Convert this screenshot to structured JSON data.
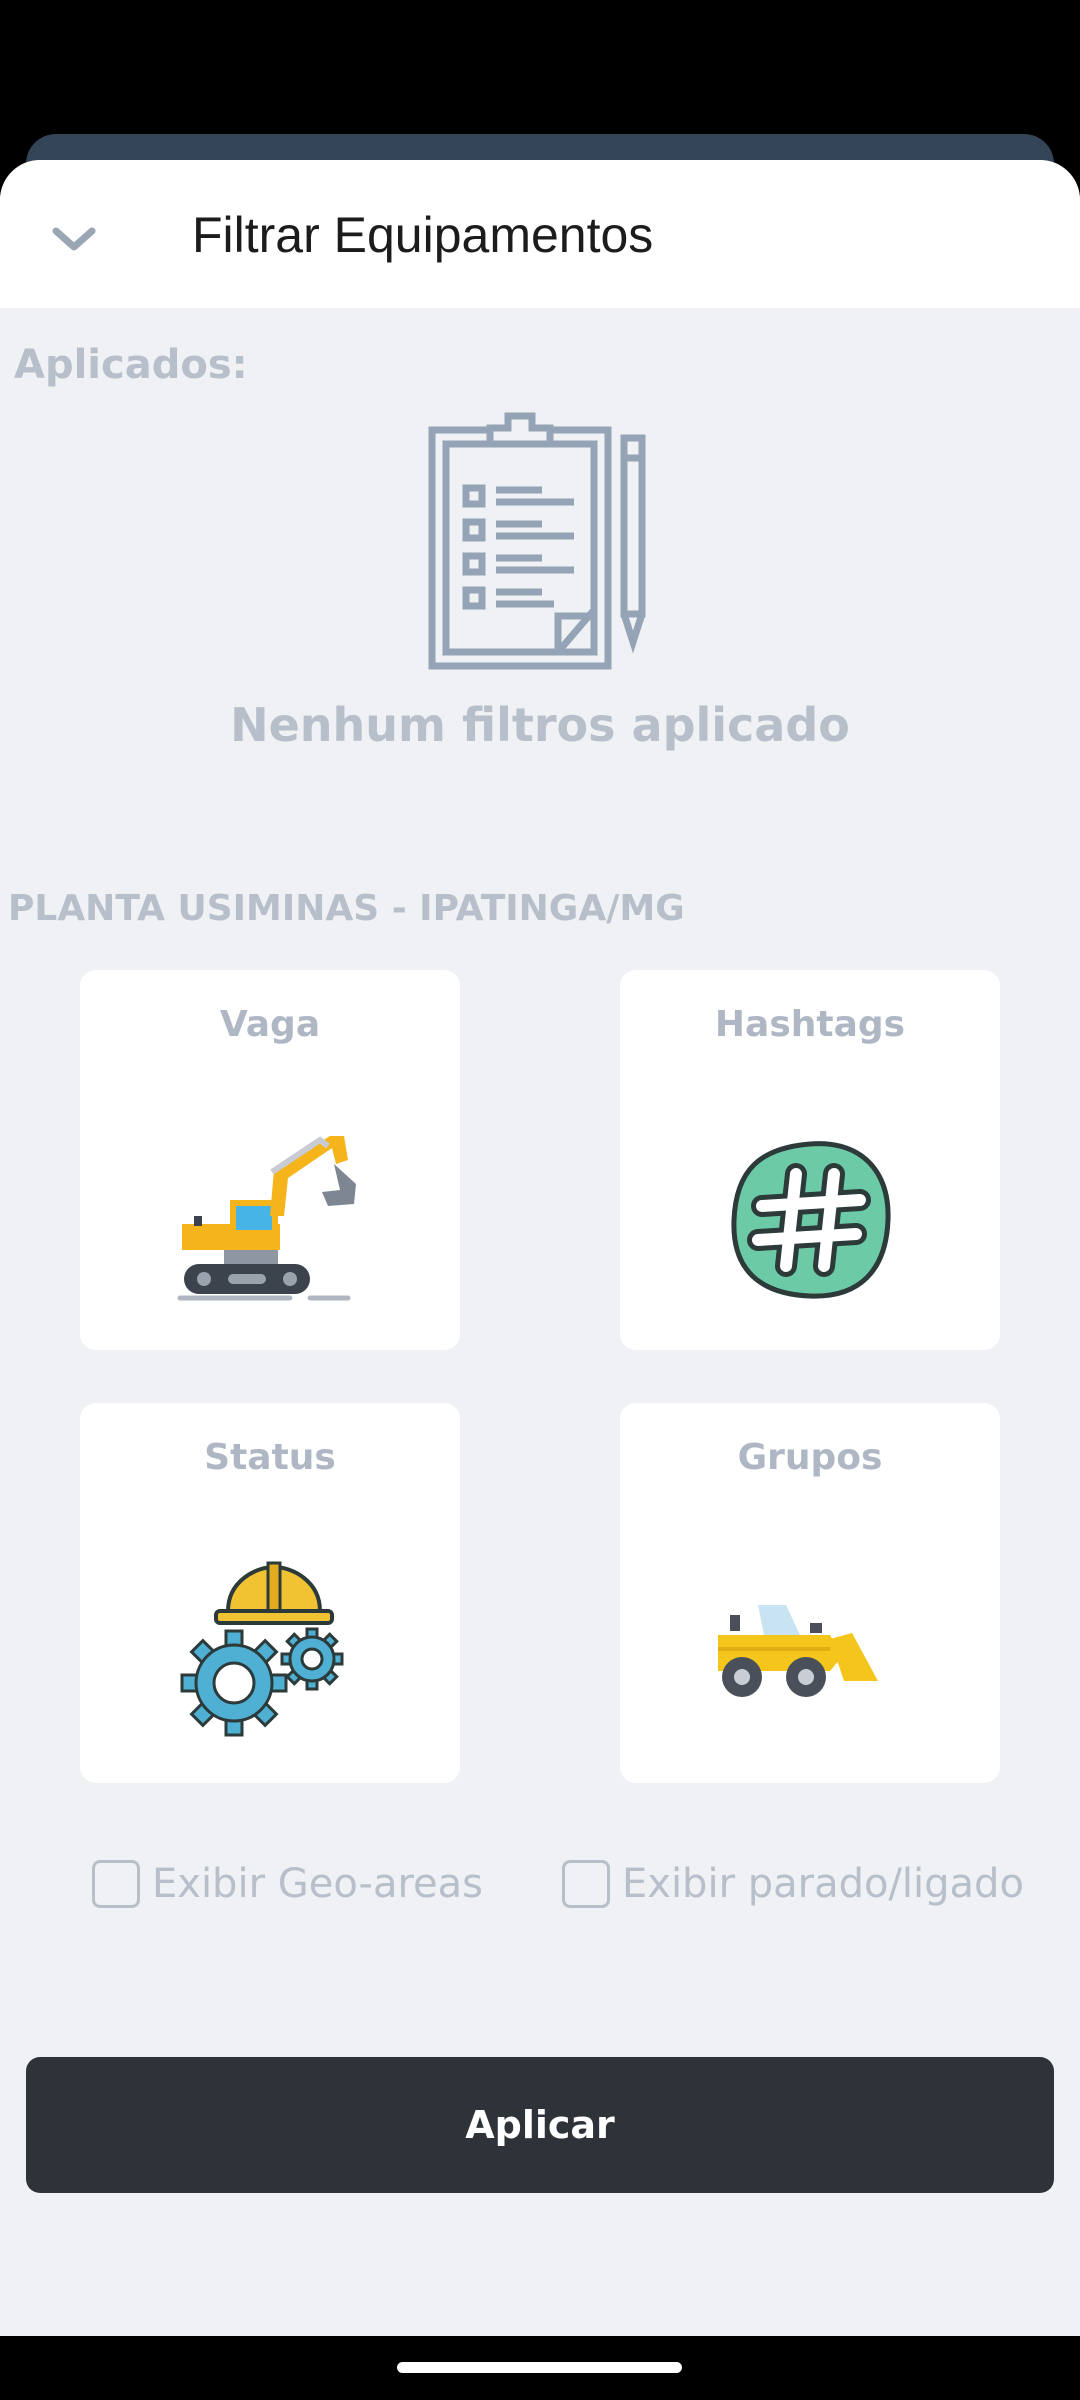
{
  "header": {
    "title": "Filtrar Equipamentos",
    "collapse_icon": "chevron-down-icon"
  },
  "applied": {
    "label": "Aplicados:",
    "empty_icon": "clipboard-checklist-icon",
    "empty_text": "Nenhum filtros aplicado"
  },
  "plant": {
    "name": "PLANTA USIMINAS - IPATINGA/MG"
  },
  "cards": [
    {
      "label": "Vaga",
      "icon": "excavator-icon"
    },
    {
      "label": "Hashtags",
      "icon": "hashtag-icon"
    },
    {
      "label": "Status",
      "icon": "worker-gears-icon"
    },
    {
      "label": "Grupos",
      "icon": "loader-vehicle-icon"
    }
  ],
  "options": {
    "geo_areas": {
      "label": "Exibir Geo-areas",
      "checked": false
    },
    "parado_ligado": {
      "label": "Exibir parado/ligado",
      "checked": false
    }
  },
  "apply_button": {
    "label": "Aplicar"
  },
  "colors": {
    "sheet_bg": "#eff1f4",
    "muted_text": "#b7bfca",
    "button_bg": "#2e3239",
    "icon_outline": "#94a3b5"
  }
}
